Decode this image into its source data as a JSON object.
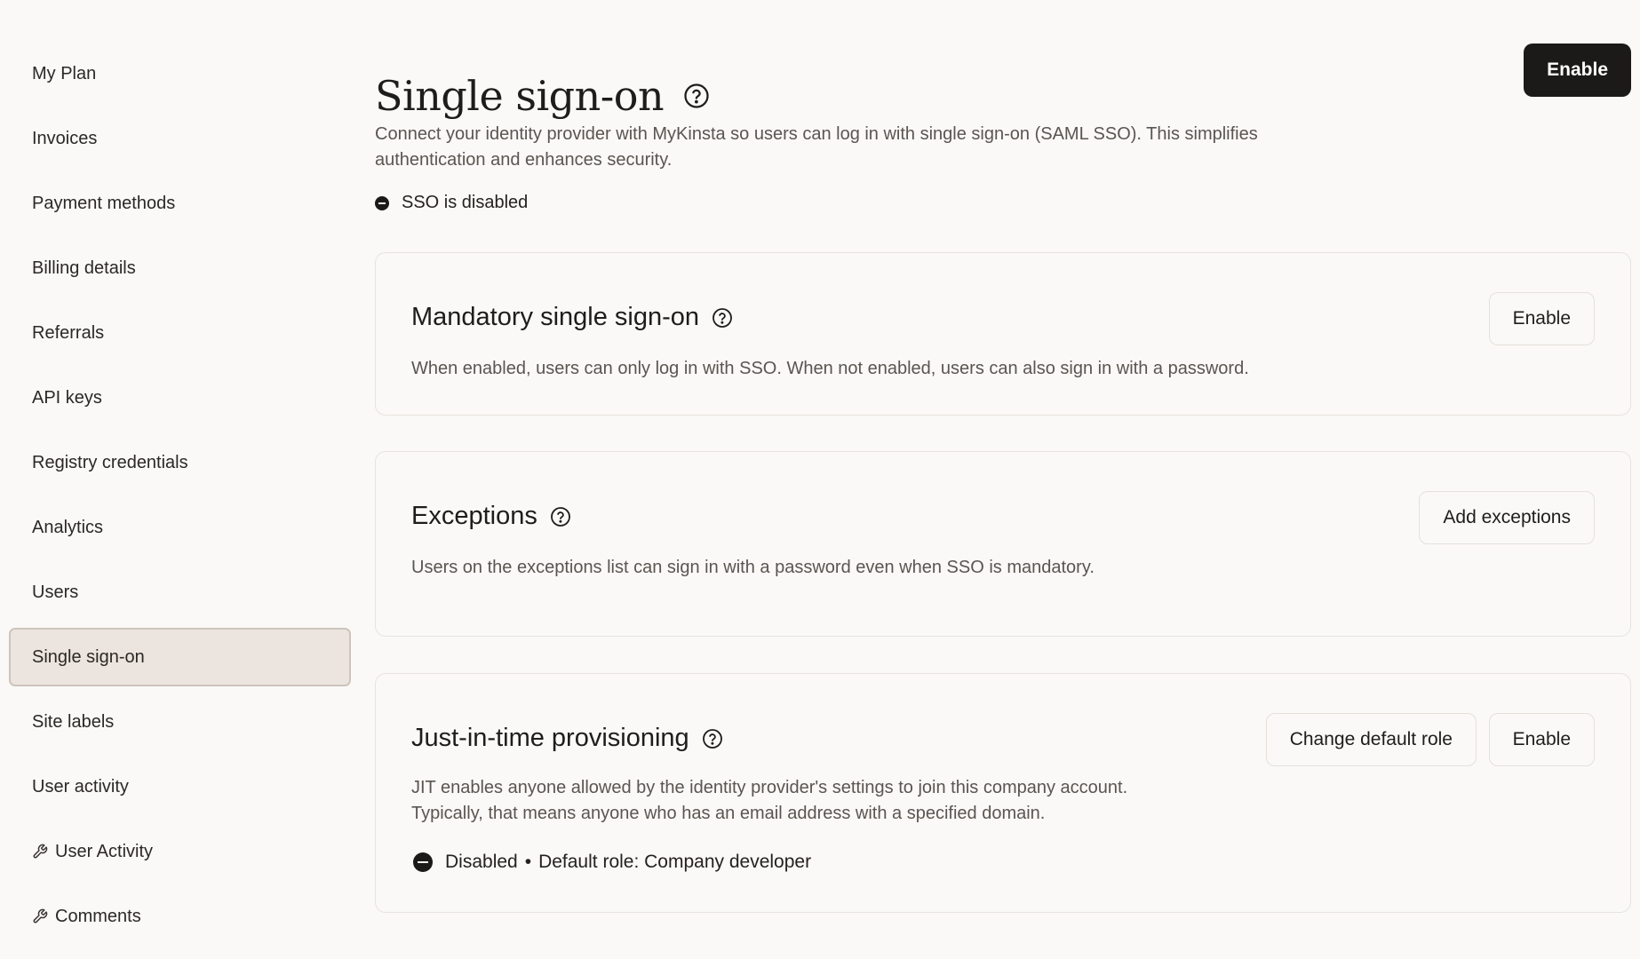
{
  "sidebar": {
    "items": [
      {
        "label": "My Plan"
      },
      {
        "label": "Invoices"
      },
      {
        "label": "Payment methods"
      },
      {
        "label": "Billing details"
      },
      {
        "label": "Referrals"
      },
      {
        "label": "API keys"
      },
      {
        "label": "Registry credentials"
      },
      {
        "label": "Analytics"
      },
      {
        "label": "Users"
      },
      {
        "label": "Single sign-on",
        "active": true
      },
      {
        "label": "Site labels"
      },
      {
        "label": "User activity"
      },
      {
        "label": "User Activity",
        "icon": "wrench-icon"
      },
      {
        "label": "Comments",
        "icon": "wrench-icon"
      }
    ]
  },
  "header": {
    "title": "Single sign-on",
    "enable_label": "Enable",
    "intro": "Connect your identity provider with MyKinsta so users can log in with single sign-on (SAML SSO). This simplifies authentication and enhances security.",
    "status": "SSO is disabled"
  },
  "cards": {
    "mandatory": {
      "title": "Mandatory single sign-on",
      "description": "When enabled, users can only log in with SSO. When not enabled, users can also sign in with a password.",
      "button": "Enable"
    },
    "exceptions": {
      "title": "Exceptions",
      "description": "Users on the exceptions list can sign in with a password even when SSO is mandatory.",
      "button": "Add exceptions"
    },
    "jit": {
      "title": "Just-in-time provisioning",
      "description_line1": "JIT enables anyone allowed by the identity provider's settings to join this company account.",
      "description_line2": "Typically, that means anyone who has an email address with a specified domain.",
      "change_role_button": "Change default role",
      "enable_button": "Enable",
      "status": "Disabled",
      "separator": "•",
      "default_role": "Default role: Company developer"
    }
  },
  "colors": {
    "background": "#faf9f7",
    "primary_button": "#1c1a18",
    "active_nav_bg": "#ece5df",
    "active_nav_border": "#cdc4bc",
    "card_border": "#e8e3de",
    "muted_text": "#5a5550"
  }
}
